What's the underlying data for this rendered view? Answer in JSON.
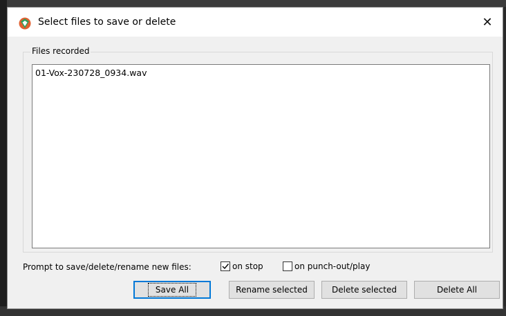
{
  "dialog": {
    "title": "Select files to save or delete",
    "close_glyph": "✕"
  },
  "files_group": {
    "label": "Files recorded",
    "files": [
      "01-Vox-230728_0934.wav"
    ]
  },
  "prompt": {
    "label": "Prompt to save/delete/rename new files:",
    "on_stop": {
      "label": "on stop",
      "checked": true
    },
    "on_punch": {
      "label": "on punch-out/play",
      "checked": false
    }
  },
  "buttons": {
    "save_all": "Save All",
    "rename_selected": "Rename selected",
    "delete_selected": "Delete selected",
    "delete_all": "Delete All"
  },
  "icons": {
    "app": "reaper-logo-icon",
    "close": "close-icon",
    "checkmark": "checkmark-icon"
  }
}
